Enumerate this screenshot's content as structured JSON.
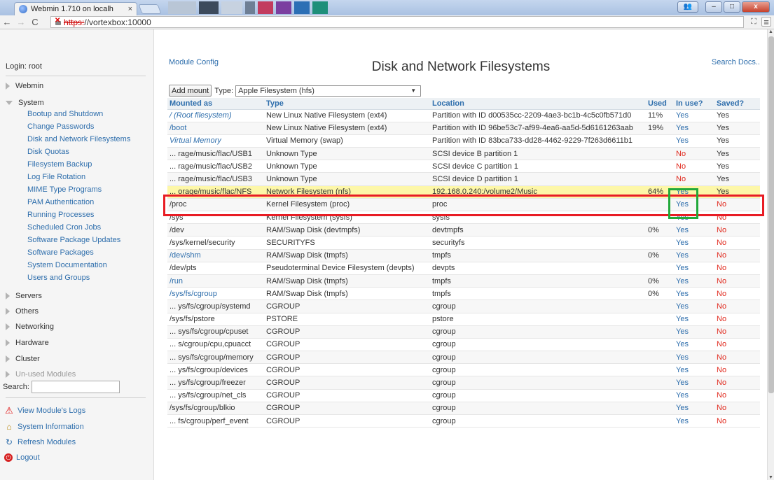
{
  "browser": {
    "tab_title": "Webmin 1.710 on localh",
    "tab_close": "×",
    "url_scheme": "https:",
    "url_rest": "//vortexbox:10000",
    "back": "←",
    "forward": "→",
    "reload": "C",
    "menu": "≡",
    "ext": "⛶",
    "win_user": "👥",
    "win_min": "–",
    "win_max": "□",
    "win_close": "x"
  },
  "sidebar": {
    "login": "Login: root",
    "categories": {
      "webmin": "Webmin",
      "system": "System",
      "servers": "Servers",
      "others": "Others",
      "networking": "Networking",
      "hardware": "Hardware",
      "cluster": "Cluster",
      "unused": "Un-used Modules"
    },
    "system_items": [
      "Bootup and Shutdown",
      "Change Passwords",
      "Disk and Network Filesystems",
      "Disk Quotas",
      "Filesystem Backup",
      "Log File Rotation",
      "MIME Type Programs",
      "PAM Authentication",
      "Running Processes",
      "Scheduled Cron Jobs",
      "Software Package Updates",
      "Software Packages",
      "System Documentation",
      "Users and Groups"
    ],
    "search_label": "Search:",
    "search_value": "",
    "actions": {
      "logs": "View Module's Logs",
      "sysinfo": "System Information",
      "refresh": "Refresh Modules",
      "logout": "Logout"
    }
  },
  "main": {
    "module_config": "Module Config",
    "title": "Disk and Network Filesystems",
    "search_docs": "Search Docs..",
    "add_mount": "Add mount",
    "type_label": "Type:",
    "type_value": "Apple Filesystem (hfs)",
    "columns": [
      "Mounted as",
      "Type",
      "Location",
      "Used",
      "In use?",
      "Saved?"
    ],
    "rows": [
      {
        "mount": "/ (Root filesystem)",
        "mstyle": "lnk it",
        "type": "New Linux Native Filesystem (ext4)",
        "location": "Partition with ID d00535cc-2209-4ae3-bc1b-4c5c0fb571d0",
        "used": "11%",
        "inuse": "Yes",
        "saved": "Yes"
      },
      {
        "mount": "/boot",
        "mstyle": "lnk",
        "type": "New Linux Native Filesystem (ext4)",
        "location": "Partition with ID 96be53c7-af99-4ea6-aa5d-5d6161263aab",
        "used": "19%",
        "inuse": "Yes",
        "saved": "Yes"
      },
      {
        "mount": "Virtual Memory",
        "mstyle": "lnk it",
        "type": "Virtual Memory (swap)",
        "location": "Partition with ID 83bca733-dd28-4462-9229-7f263d6611b1",
        "used": "",
        "inuse": "Yes",
        "saved": "Yes"
      },
      {
        "mount": "... rage/music/flac/USB1",
        "mstyle": "plain",
        "type": "Unknown Type",
        "location": "SCSI device B partition 1",
        "used": "",
        "inuse": "No",
        "saved": "Yes"
      },
      {
        "mount": "... rage/music/flac/USB2",
        "mstyle": "plain",
        "type": "Unknown Type",
        "location": "SCSI device C partition 1",
        "used": "",
        "inuse": "No",
        "saved": "Yes"
      },
      {
        "mount": "... rage/music/flac/USB3",
        "mstyle": "plain",
        "type": "Unknown Type",
        "location": "SCSI device D partition 1",
        "used": "",
        "inuse": "No",
        "saved": "Yes"
      },
      {
        "mount": "... orage/music/flac/NFS",
        "mstyle": "plain",
        "type": "Network Filesystem (nfs)",
        "location": "192.168.0.240:/volume2/Music",
        "used": "64%",
        "inuse": "Yes",
        "saved": "Yes",
        "highlight": true
      },
      {
        "mount": "/proc",
        "mstyle": "plain",
        "type": "Kernel Filesystem (proc)",
        "location": "proc",
        "used": "",
        "inuse": "Yes",
        "saved": "No"
      },
      {
        "mount": "/sys",
        "mstyle": "plain",
        "type": "Kernel Filesystem (sysfs)",
        "location": "sysfs",
        "used": "",
        "inuse": "Yes",
        "saved": "No"
      },
      {
        "mount": "/dev",
        "mstyle": "plain",
        "type": "RAM/Swap Disk (devtmpfs)",
        "location": "devtmpfs",
        "used": "0%",
        "inuse": "Yes",
        "saved": "No"
      },
      {
        "mount": "/sys/kernel/security",
        "mstyle": "plain",
        "type": "SECURITYFS",
        "location": "securityfs",
        "used": "",
        "inuse": "Yes",
        "saved": "No"
      },
      {
        "mount": "/dev/shm",
        "mstyle": "lnk",
        "type": "RAM/Swap Disk (tmpfs)",
        "location": "tmpfs",
        "used": "0%",
        "inuse": "Yes",
        "saved": "No"
      },
      {
        "mount": "/dev/pts",
        "mstyle": "plain",
        "type": "Pseudoterminal Device Filesystem (devpts)",
        "location": "devpts",
        "used": "",
        "inuse": "Yes",
        "saved": "No"
      },
      {
        "mount": "/run",
        "mstyle": "lnk",
        "type": "RAM/Swap Disk (tmpfs)",
        "location": "tmpfs",
        "used": "0%",
        "inuse": "Yes",
        "saved": "No"
      },
      {
        "mount": "/sys/fs/cgroup",
        "mstyle": "lnk",
        "type": "RAM/Swap Disk (tmpfs)",
        "location": "tmpfs",
        "used": "0%",
        "inuse": "Yes",
        "saved": "No"
      },
      {
        "mount": "... ys/fs/cgroup/systemd",
        "mstyle": "plain",
        "type": "CGROUP",
        "location": "cgroup",
        "used": "",
        "inuse": "Yes",
        "saved": "No"
      },
      {
        "mount": "/sys/fs/pstore",
        "mstyle": "plain",
        "type": "PSTORE",
        "location": "pstore",
        "used": "",
        "inuse": "Yes",
        "saved": "No"
      },
      {
        "mount": "... sys/fs/cgroup/cpuset",
        "mstyle": "plain",
        "type": "CGROUP",
        "location": "cgroup",
        "used": "",
        "inuse": "Yes",
        "saved": "No"
      },
      {
        "mount": "... s/cgroup/cpu,cpuacct",
        "mstyle": "plain",
        "type": "CGROUP",
        "location": "cgroup",
        "used": "",
        "inuse": "Yes",
        "saved": "No"
      },
      {
        "mount": "... sys/fs/cgroup/memory",
        "mstyle": "plain",
        "type": "CGROUP",
        "location": "cgroup",
        "used": "",
        "inuse": "Yes",
        "saved": "No"
      },
      {
        "mount": "... ys/fs/cgroup/devices",
        "mstyle": "plain",
        "type": "CGROUP",
        "location": "cgroup",
        "used": "",
        "inuse": "Yes",
        "saved": "No"
      },
      {
        "mount": "... ys/fs/cgroup/freezer",
        "mstyle": "plain",
        "type": "CGROUP",
        "location": "cgroup",
        "used": "",
        "inuse": "Yes",
        "saved": "No"
      },
      {
        "mount": "... ys/fs/cgroup/net_cls",
        "mstyle": "plain",
        "type": "CGROUP",
        "location": "cgroup",
        "used": "",
        "inuse": "Yes",
        "saved": "No"
      },
      {
        "mount": "/sys/fs/cgroup/blkio",
        "mstyle": "plain",
        "type": "CGROUP",
        "location": "cgroup",
        "used": "",
        "inuse": "Yes",
        "saved": "No"
      },
      {
        "mount": "... fs/cgroup/perf_event",
        "mstyle": "plain",
        "type": "CGROUP",
        "location": "cgroup",
        "used": "",
        "inuse": "Yes",
        "saved": "No"
      }
    ]
  },
  "colors": {
    "link": "#2e6eac",
    "no": "#e0281c",
    "highlight_row": "#fdf7a8",
    "annotation_red": "#e81c24",
    "annotation_green": "#22a93a"
  }
}
